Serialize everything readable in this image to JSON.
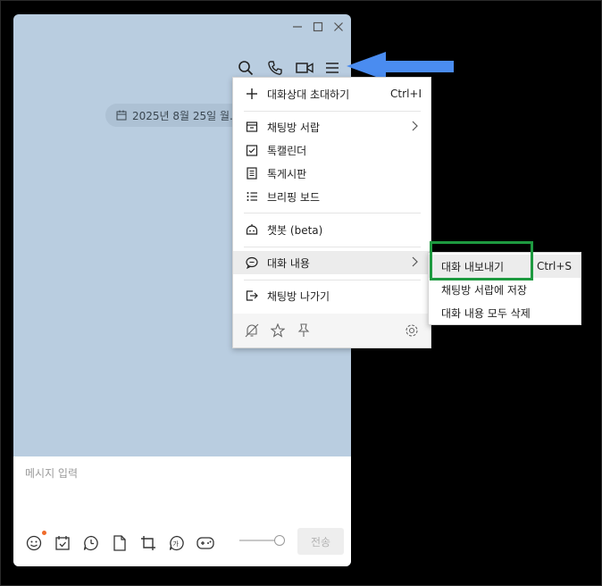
{
  "window": {
    "controls": [
      "minimize",
      "maximize",
      "close"
    ],
    "toolbar_icons": [
      "search-icon",
      "phone-icon",
      "video-call-icon",
      "menu-icon"
    ],
    "date_label": "2025년 8월 25일 월.."
  },
  "menu": {
    "items": [
      {
        "label": "대화상대 초대하기",
        "shortcut": "Ctrl+I",
        "icon": "plus-icon"
      },
      {
        "label": "채팅방 서랍",
        "icon": "drawer-icon",
        "has_submenu": true
      },
      {
        "label": "톡캘린더",
        "icon": "calendar-check-icon"
      },
      {
        "label": "톡게시판",
        "icon": "board-icon"
      },
      {
        "label": "브리핑 보드",
        "icon": "list-icon"
      },
      {
        "label": "챗봇 (beta)",
        "icon": "bot-icon"
      },
      {
        "label": "대화 내용",
        "icon": "chat-bubble-icon",
        "has_submenu": true,
        "active": true
      },
      {
        "label": "채팅방 나가기",
        "icon": "exit-icon"
      }
    ],
    "bottom_icons": [
      "mute-bell-icon",
      "star-icon",
      "pin-icon",
      "settings-icon"
    ]
  },
  "submenu": {
    "items": [
      {
        "label": "대화 내보내기",
        "shortcut": "Ctrl+S",
        "highlighted": true
      },
      {
        "label": "채팅방 서랍에 저장"
      },
      {
        "label": "대화 내용 모두 삭제"
      }
    ]
  },
  "input": {
    "placeholder": "메시지 입력",
    "send_label": "전송",
    "toolbar_icons": [
      "emoji-icon",
      "calendar-icon",
      "clock-icon",
      "file-icon",
      "crop-icon",
      "translate-icon",
      "game-icon"
    ]
  },
  "colors": {
    "chat_background": "#b9cde0",
    "annotation_arrow": "#4a8cf0",
    "annotation_box": "#1e9a40"
  }
}
